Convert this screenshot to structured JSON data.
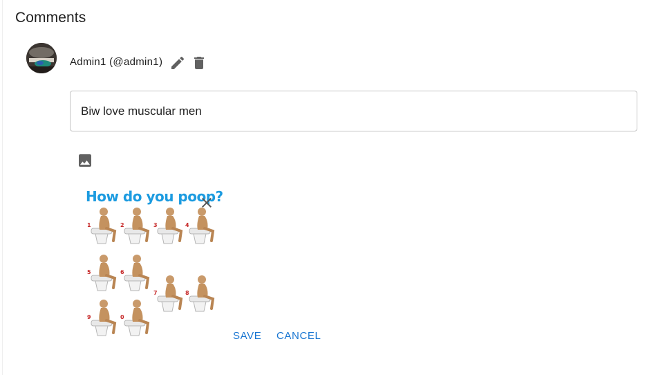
{
  "section": {
    "title": "Comments"
  },
  "comment": {
    "author": "Admin1 (@admin1)",
    "text": "Biw love muscular men",
    "icons": {
      "edit": "pencil-icon",
      "delete": "trash-icon",
      "image": "image-icon",
      "close": "close-icon"
    },
    "attachment": {
      "heading": "How do you poop?",
      "labels": [
        "1",
        "2",
        "3",
        "4",
        "5",
        "6",
        "7",
        "8",
        "9",
        "0"
      ]
    }
  },
  "actions": {
    "save_label": "SAVE",
    "cancel_label": "CANCEL"
  },
  "colors": {
    "accent": "#1976d2",
    "icon": "#616161",
    "border": "#c4c4c4",
    "text": "#212121"
  }
}
